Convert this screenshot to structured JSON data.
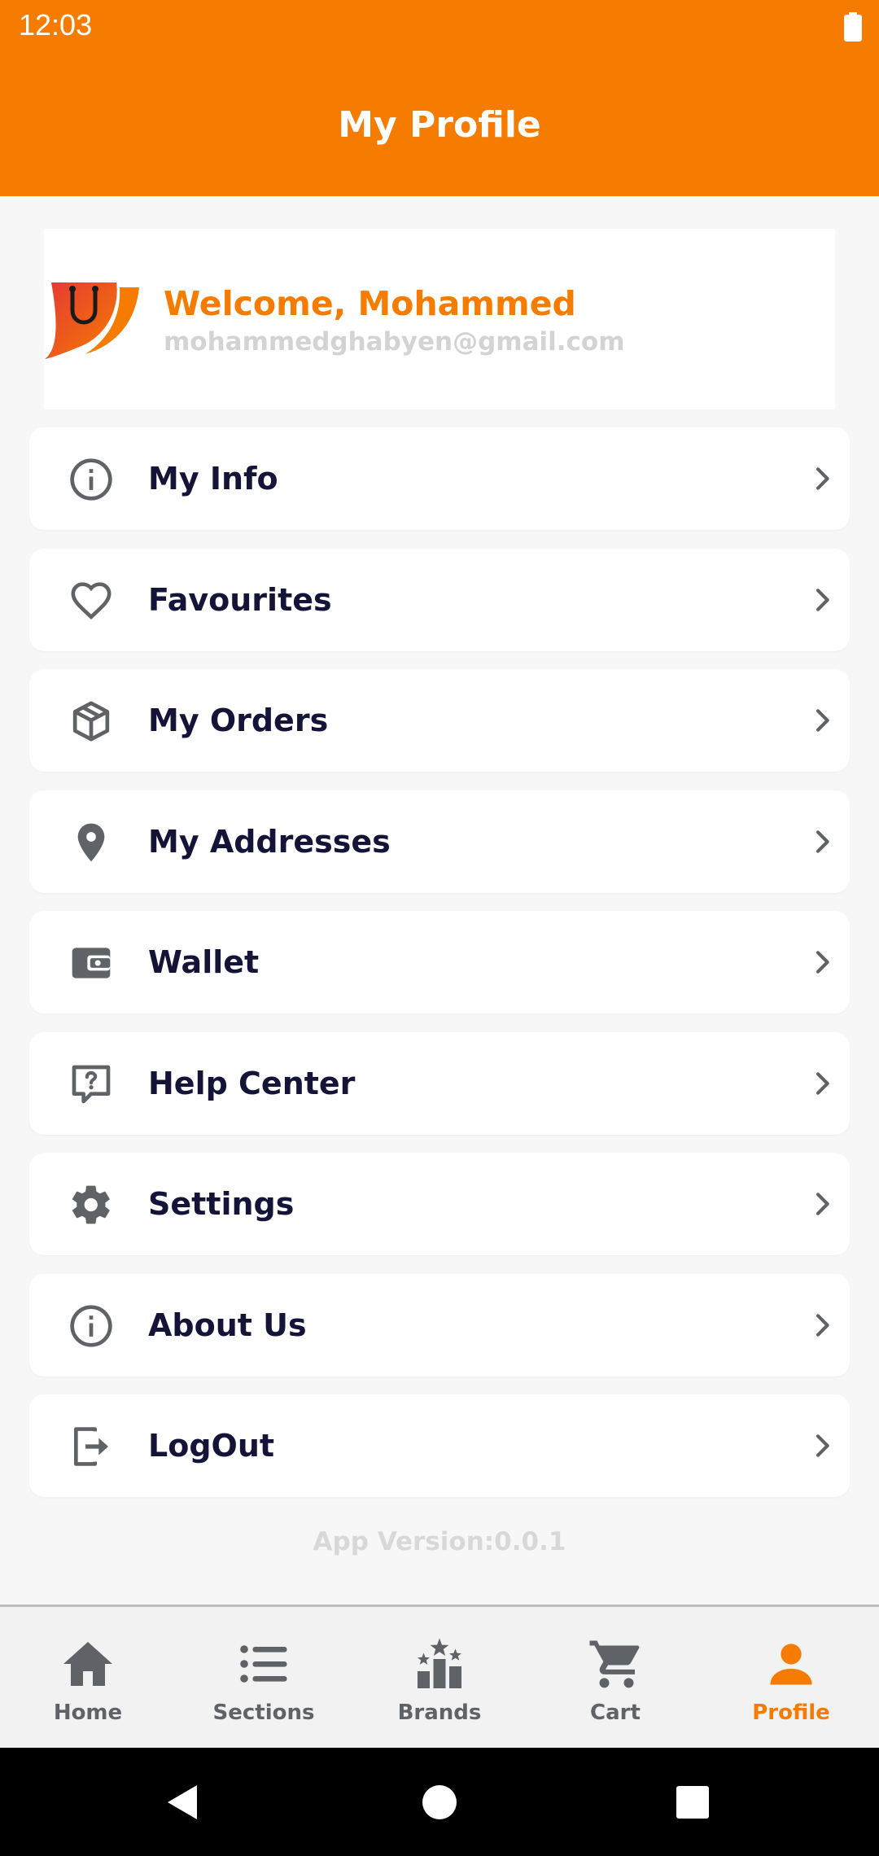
{
  "status_bar": {
    "time": "12:03"
  },
  "header": {
    "title": "My Profile"
  },
  "profile": {
    "welcome": "Welcome, Mohammed",
    "email": "mohammedghabyen@gmail.com"
  },
  "menu": {
    "items": [
      {
        "label": "My Info",
        "icon": "info-icon"
      },
      {
        "label": "Favourites",
        "icon": "heart-icon"
      },
      {
        "label": "My Orders",
        "icon": "box-icon"
      },
      {
        "label": "My Addresses",
        "icon": "location-pin-icon"
      },
      {
        "label": "Wallet",
        "icon": "wallet-icon"
      },
      {
        "label": "Help Center",
        "icon": "help-icon"
      },
      {
        "label": "Settings",
        "icon": "gear-icon"
      },
      {
        "label": "About Us",
        "icon": "info-icon"
      },
      {
        "label": "LogOut",
        "icon": "logout-icon"
      }
    ]
  },
  "footer": {
    "app_version": "App Version:0.0.1"
  },
  "bottom_nav": {
    "items": [
      {
        "label": "Home",
        "icon": "home-icon"
      },
      {
        "label": "Sections",
        "icon": "list-icon"
      },
      {
        "label": "Brands",
        "icon": "brands-icon"
      },
      {
        "label": "Cart",
        "icon": "cart-icon"
      },
      {
        "label": "Profile",
        "icon": "person-icon"
      }
    ],
    "active": "Profile"
  },
  "colors": {
    "accent": "#f57c00",
    "text_dark": "#141438",
    "icon_gray": "#5f6368",
    "muted": "#d3d3d3"
  }
}
